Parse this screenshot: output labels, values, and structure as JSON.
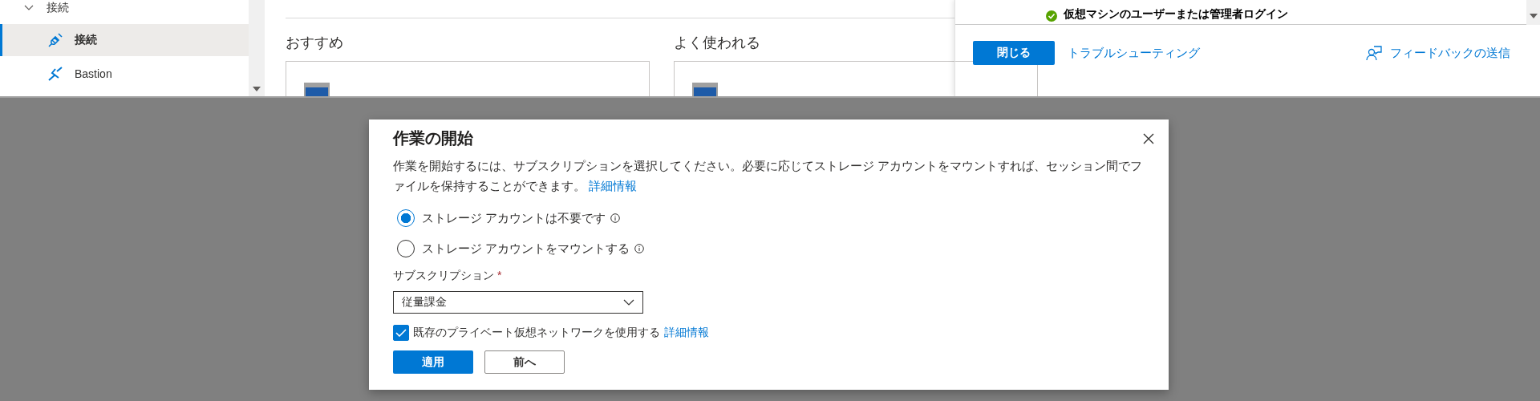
{
  "sidebar": {
    "items": [
      {
        "kind": "group",
        "label": "接続",
        "expanded": true
      },
      {
        "kind": "plug",
        "label": "接続",
        "selected": true
      },
      {
        "kind": "bastion",
        "label": "Bastion",
        "selected": false
      }
    ]
  },
  "main": {
    "sections": [
      {
        "heading": "おすすめ"
      },
      {
        "heading": "よく使われる"
      }
    ]
  },
  "panel": {
    "step": {
      "label": "仮想マシンのユーザーまたは管理者ログイン",
      "done": true
    },
    "close_button": "閉じる",
    "troubleshoot_link": "トラブルシューティング",
    "feedback_link": "フィードバックの送信"
  },
  "dialog": {
    "title": "作業の開始",
    "description": "作業を開始するには、サブスクリプションを選択してください。必要に応じてストレージ アカウントをマウントすれば、セッション間でファイルを保持することができます。",
    "description_link": "詳細情報",
    "options": [
      {
        "label": "ストレージ アカウントは不要です",
        "selected": true
      },
      {
        "label": "ストレージ アカウントをマウントする",
        "selected": false
      }
    ],
    "subscription": {
      "label": "サブスクリプション",
      "required_mark": "*",
      "value": "従量課金"
    },
    "checkbox": {
      "label": "既存のプライベート仮想ネットワークを使用する",
      "checked": true,
      "link": "詳細情報"
    },
    "buttons": [
      {
        "label": "適用",
        "kind": "primary"
      },
      {
        "label": "前へ",
        "kind": "secondary"
      }
    ]
  }
}
